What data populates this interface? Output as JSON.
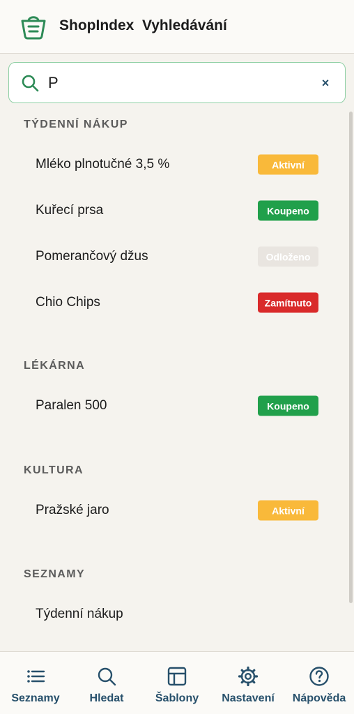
{
  "header": {
    "title": "ShopIndex  Vyhledávání",
    "logo_icon": "shopping-bag-icon",
    "accent": "#2e8b57"
  },
  "search": {
    "value": "P",
    "placeholder": "",
    "clear_label": "×"
  },
  "colors": {
    "active": "#f9b93a",
    "bought": "#21a04b",
    "postponed": "#e9e5e0",
    "rejected": "#d92a2a",
    "nav_text": "#27506b"
  },
  "sections": [
    {
      "title": "TÝDENNÍ NÁKUP",
      "items": [
        {
          "label": "Mléko plnotučné 3,5 %",
          "status": "Aktivní",
          "status_kind": "active"
        },
        {
          "label": "Kuřecí prsa",
          "status": "Koupeno",
          "status_kind": "bought"
        },
        {
          "label": "Pomerančový džus",
          "status": "Odloženo",
          "status_kind": "postponed"
        },
        {
          "label": "Chio Chips",
          "status": "Zamítnuto",
          "status_kind": "rejected"
        }
      ]
    },
    {
      "title": "LÉKÁRNA",
      "items": [
        {
          "label": "Paralen 500",
          "status": "Koupeno",
          "status_kind": "bought"
        }
      ]
    },
    {
      "title": "KULTURA",
      "items": [
        {
          "label": "Pražské jaro",
          "status": "Aktivní",
          "status_kind": "active"
        }
      ]
    },
    {
      "title": "SEZNAMY",
      "items": [
        {
          "label": "Týdenní nákup",
          "status": "",
          "status_kind": ""
        }
      ]
    }
  ],
  "nav": [
    {
      "label": "Seznamy",
      "icon": "list-icon"
    },
    {
      "label": "Hledat",
      "icon": "search-icon"
    },
    {
      "label": "Šablony",
      "icon": "template-icon"
    },
    {
      "label": "Nastavení",
      "icon": "gear-icon"
    },
    {
      "label": "Nápověda",
      "icon": "help-icon"
    }
  ]
}
